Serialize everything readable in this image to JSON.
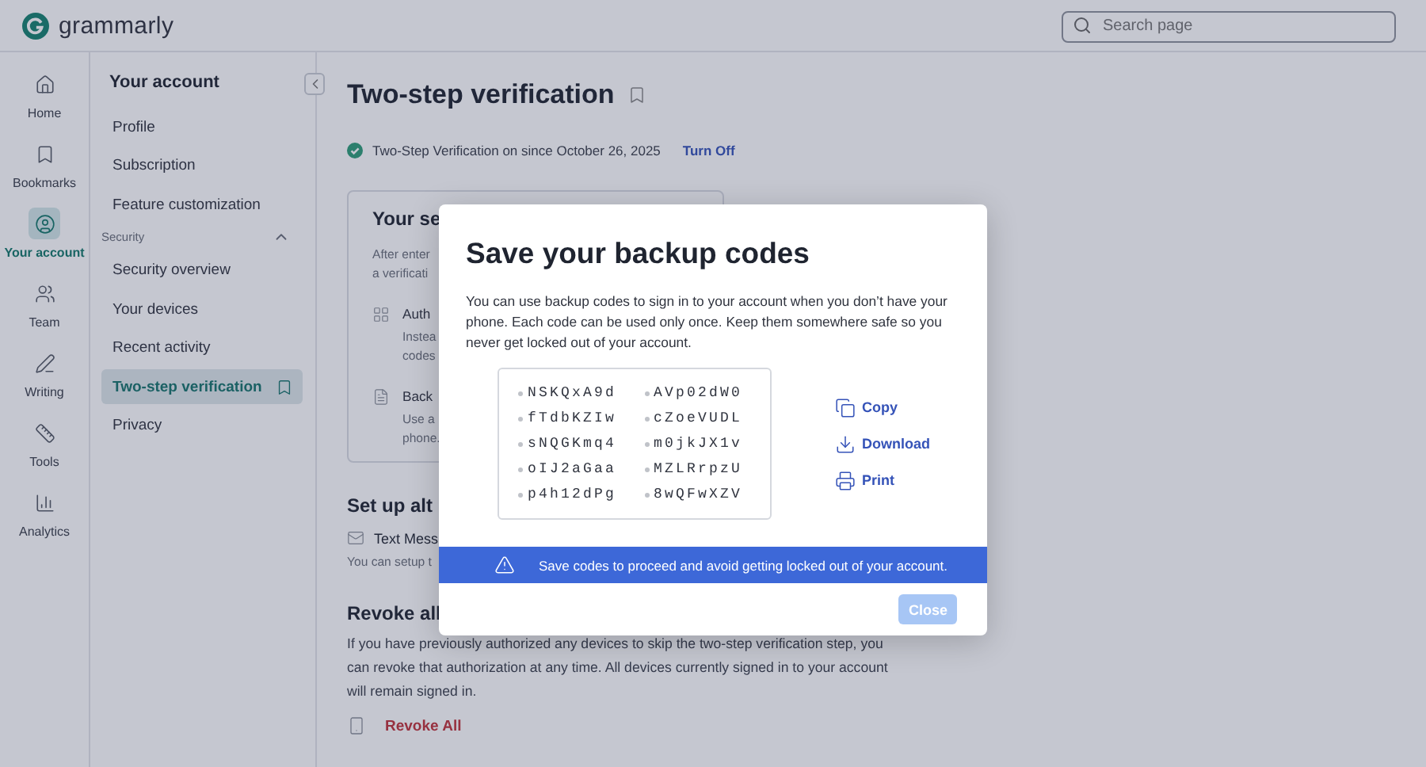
{
  "topbar": {
    "brand": "grammarly",
    "search": {
      "placeholder": "Search page"
    }
  },
  "rail": [
    {
      "label": "Home",
      "kind": "home",
      "selected": false
    },
    {
      "label": "Bookmarks",
      "kind": "bookmark",
      "selected": false
    },
    {
      "label": "Your account",
      "kind": "user",
      "selected": true
    },
    {
      "label": "Team",
      "kind": "team",
      "selected": false
    },
    {
      "label": "Writing",
      "kind": "pen",
      "selected": false
    },
    {
      "label": "Tools",
      "kind": "tools",
      "selected": false
    },
    {
      "label": "Analytics",
      "kind": "chart",
      "selected": false
    }
  ],
  "account_menu": {
    "title": "Your account",
    "items": [
      {
        "label": "Profile",
        "selected": false
      },
      {
        "label": "Subscription",
        "selected": false
      },
      {
        "label": "Feature customization",
        "selected": false
      }
    ],
    "group": {
      "label": "Security",
      "expanded": true,
      "children": [
        {
          "label": "Security overview",
          "selected": false
        },
        {
          "label": "Your devices",
          "selected": false
        },
        {
          "label": "Recent activity",
          "selected": false
        },
        {
          "label": "Two-step verification",
          "selected": true
        },
        {
          "label": "Privacy",
          "selected": false
        }
      ]
    }
  },
  "main": {
    "title": "Two-step verification",
    "status": {
      "on": true,
      "text": "Two-Step Verification on since October 26, 2025",
      "action": "Turn Off"
    },
    "card": {
      "title": "Your se",
      "intro": [
        "After enter",
        "a verificati"
      ],
      "methods": [
        {
          "kind": "grid",
          "title": "Auth",
          "lines": [
            "Instea",
            "codes"
          ]
        },
        {
          "kind": "file",
          "title": "Back",
          "lines": [
            "Use a",
            "phone."
          ]
        }
      ]
    },
    "alternate": {
      "title": "Set up alt",
      "option": "Text Mess",
      "note": "You can setup t"
    },
    "revoke": {
      "title": "Revoke all",
      "text": "If you have previously authorized any devices to skip the two-step verification step, you can revoke that authorization at any time. All devices currently signed in to your account will remain signed in.",
      "action": "Revoke All"
    }
  },
  "modal": {
    "title": "Save your backup codes",
    "body": "You can use backup codes to sign in to your account when you don’t have your phone. Each code can be used only once. Keep them somewhere safe so you never get locked out of your account.",
    "codes": [
      "NSKQxA9d",
      "fTdbKZIw",
      "sNQGKmq4",
      "oIJ2aGaa",
      "p4h12dPg",
      "AVp02dW0",
      "cZoeVUDL",
      "m0jkJX1v",
      "MZLRrpzU",
      "8wQFwXZV"
    ],
    "actions": [
      {
        "label": "Copy",
        "kind": "copy"
      },
      {
        "label": "Download",
        "kind": "download"
      },
      {
        "label": "Print",
        "kind": "print"
      }
    ],
    "warning": "Save codes to proceed and avoid getting locked out of your account.",
    "close": {
      "label": "Close",
      "disabled": true
    }
  }
}
